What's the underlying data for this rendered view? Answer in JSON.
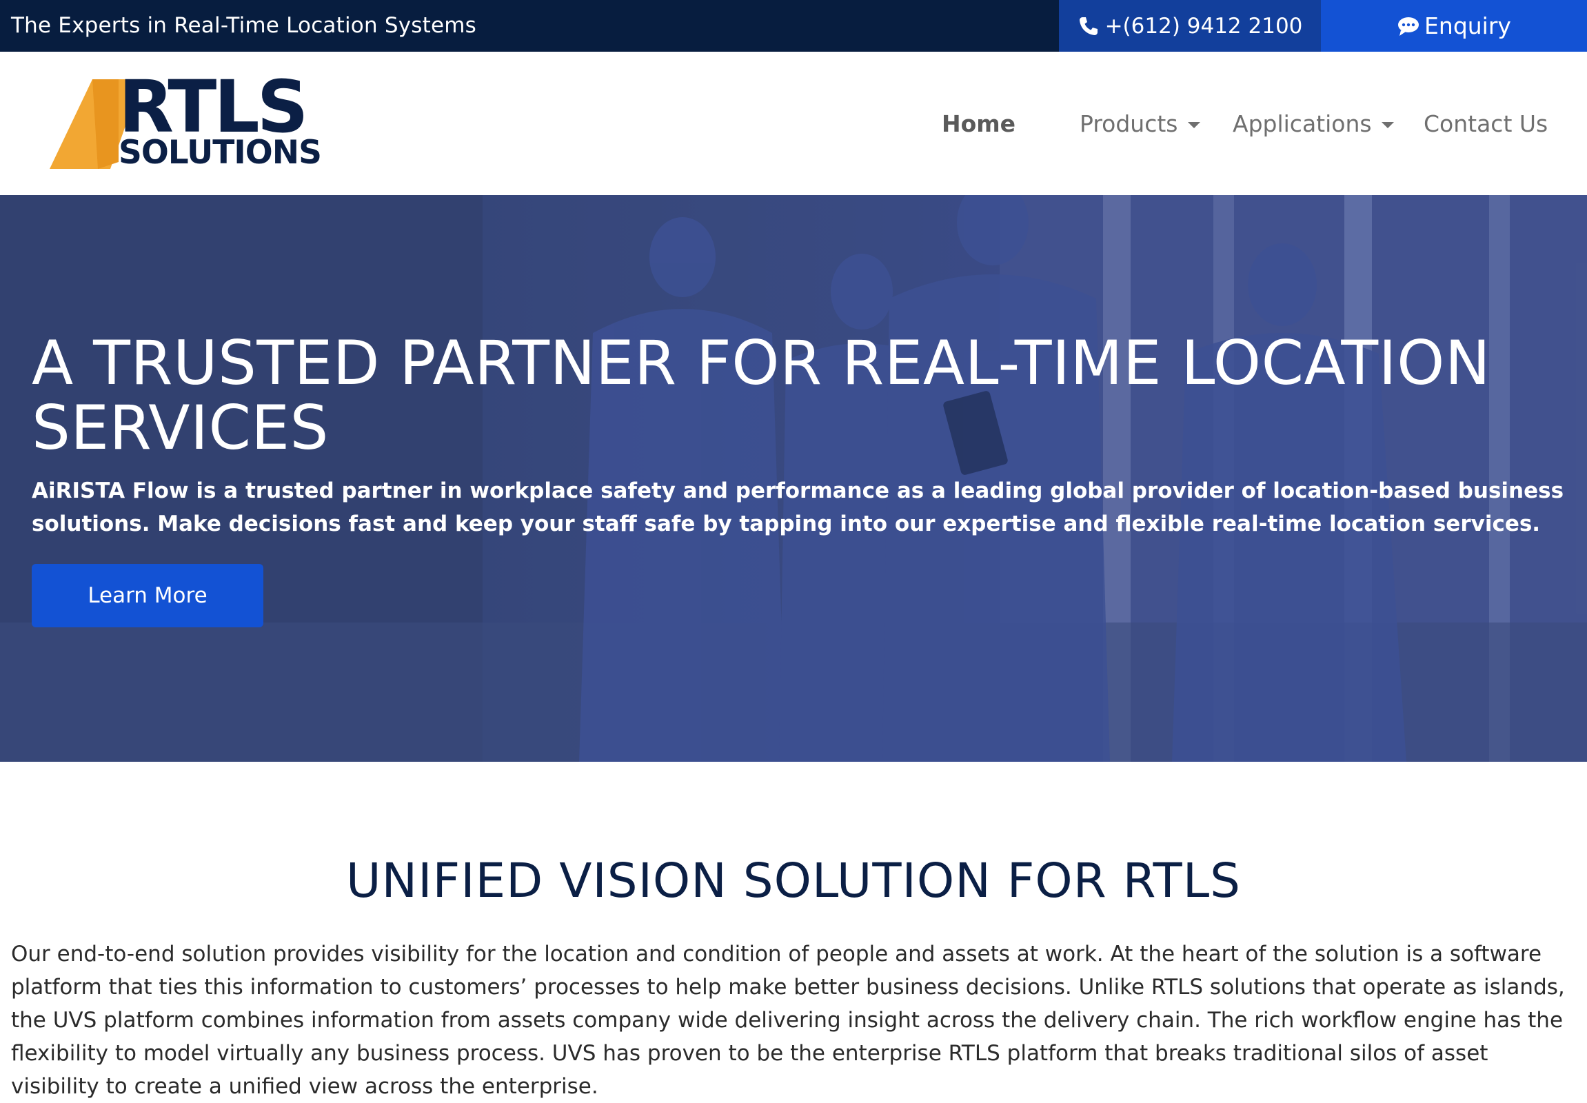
{
  "topbar": {
    "tagline": "The Experts in Real-Time Location Systems",
    "phone": "+(612) 9412 2100",
    "phone_icon": "phone-icon",
    "enquiry": "Enquiry",
    "enquiry_icon": "chat-bubble-icon"
  },
  "logo": {
    "line1": "RTLS",
    "line2": "SOLUTIONS",
    "accent_color": "#f2a733",
    "text_color": "#0b1f45"
  },
  "nav": {
    "home": "Home",
    "products": "Products",
    "applications": "Applications",
    "contact": "Contact Us"
  },
  "hero": {
    "title": "A TRUSTED PARTNER FOR REAL-TIME LOCATION\nSERVICES",
    "text": "AiRISTA Flow is a trusted partner in workplace safety and performance as a leading global provider of location-based business solutions. Make decisions fast and keep your staff safe by tapping into our expertise and flexible real-time location services.",
    "button": "Learn More"
  },
  "section": {
    "title": "UNIFIED VISION SOLUTION FOR RTLS",
    "body": "Our end-to-end solution provides visibility for the location and condition of people and assets at work. At the heart of the solution is a software platform that ties this information to customers’ processes to help make better business decisions. Unlike RTLS solutions that operate as islands, the UVS platform combines information from assets company wide delivering insight across the delivery chain. The rich workflow engine has the flexibility to model virtually any business process. UVS has proven to be the enterprise RTLS platform that breaks traditional silos of asset visibility to create a unified view across the enterprise."
  },
  "colors": {
    "topbar_bg": "#071d3f",
    "phone_bg": "#123f9c",
    "enquiry_bg": "#1352d4",
    "button_bg": "#1352d4",
    "heading": "#0b1f45"
  }
}
